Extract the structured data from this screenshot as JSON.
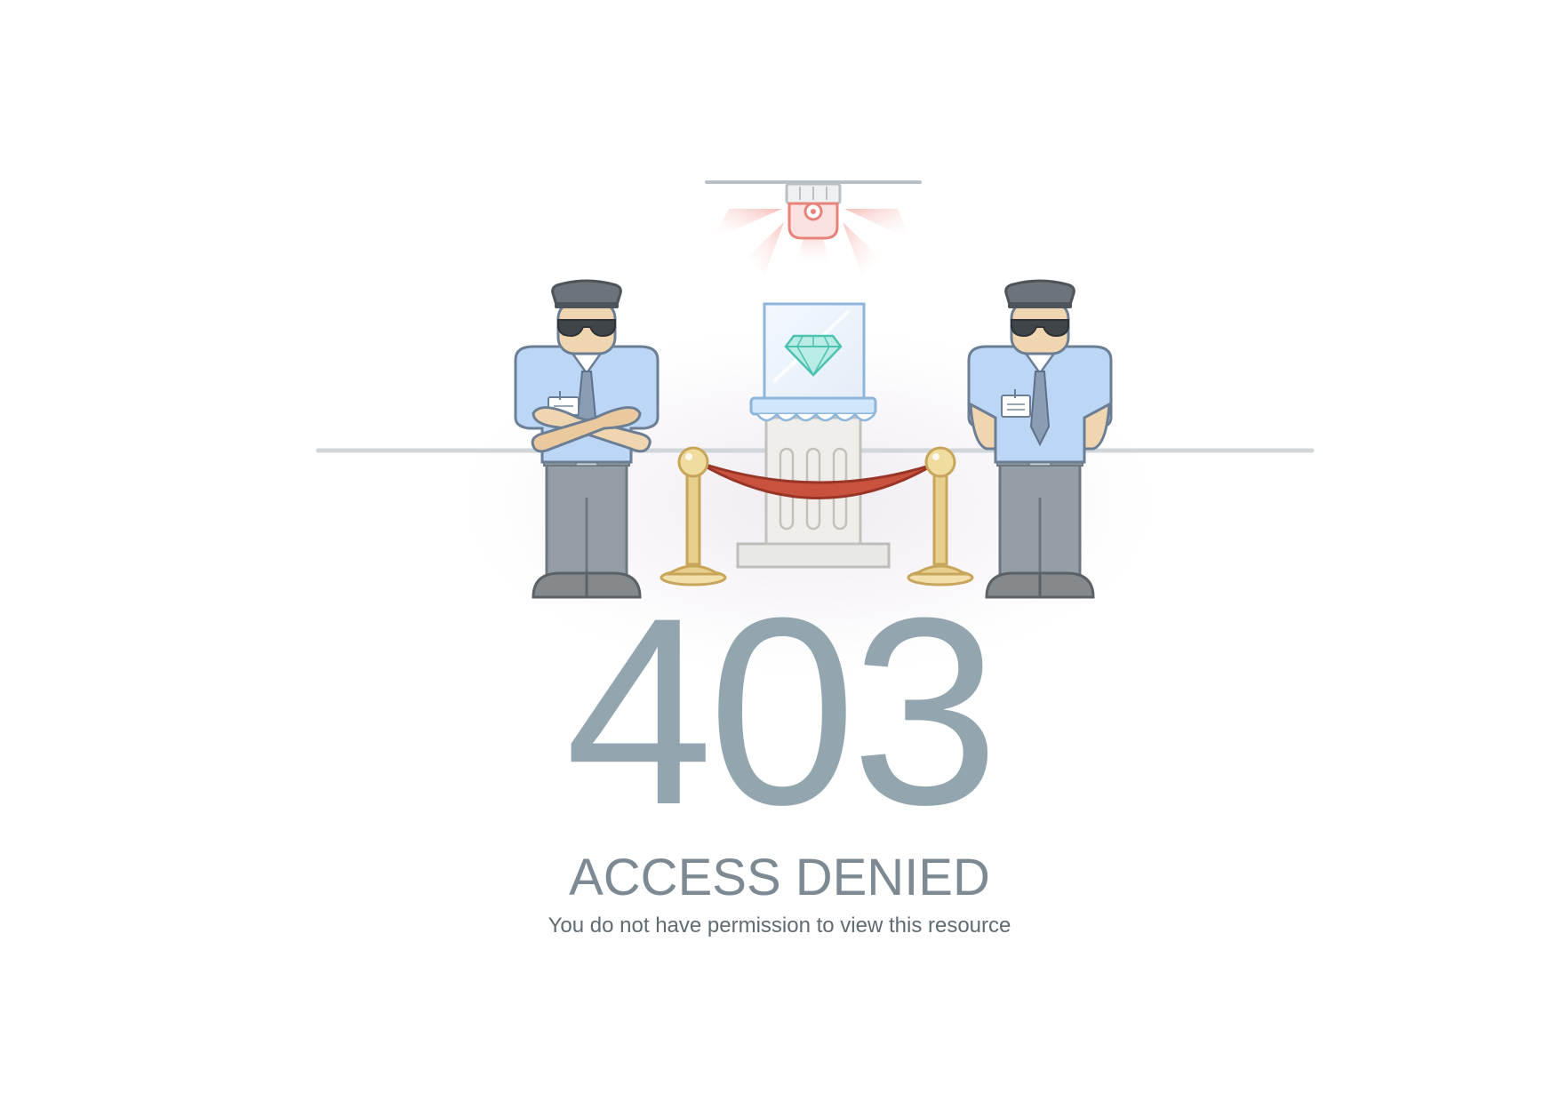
{
  "page": {
    "error_code": "403",
    "title": "ACCESS DENIED",
    "message": "You do not have permission to view this resource"
  },
  "illustration": {
    "icons": [
      "security-camera-icon",
      "guard-left-icon",
      "guard-right-icon",
      "diamond-display-case-icon",
      "stanchion-left-icon",
      "stanchion-right-icon",
      "velvet-rope-icon"
    ]
  },
  "colors": {
    "code_text": "#93a5ae",
    "title_text": "#7d8a93",
    "message_text": "#5f6b73",
    "alarm_red": "#e8837c",
    "guard_shirt": "#bcd6f5",
    "guard_pants": "#939ea6",
    "brass": "#e7cf8e",
    "rope": "#c9523f",
    "diamond": "#6fd3c6"
  }
}
